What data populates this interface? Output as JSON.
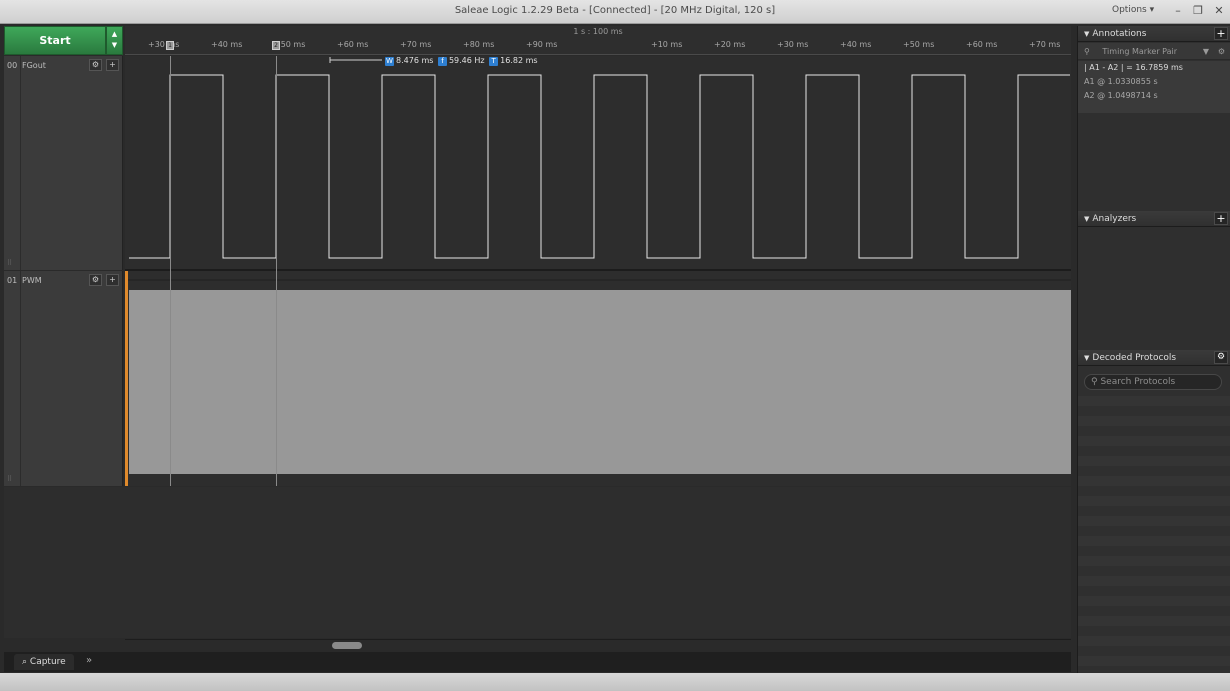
{
  "window": {
    "title": "Saleae Logic 1.2.29 Beta - [Connected] - [20 MHz Digital, 120 s]",
    "options_label": "Options ▾",
    "minimize_icon": "minimize-icon",
    "restore_icon": "restore-icon",
    "close_icon": "close-icon"
  },
  "toolbar": {
    "start_label": "Start"
  },
  "ruler": {
    "scale_label": "1 s : 100 ms",
    "ticks": [
      "+30 ms",
      "+40 ms",
      "+50 ms",
      "+60 ms",
      "+70 ms",
      "+80 ms",
      "+90 ms",
      "+10 ms",
      "+20 ms",
      "+30 ms",
      "+40 ms",
      "+50 ms",
      "+60 ms",
      "+70 ms"
    ],
    "marker_a1": "A1",
    "marker_a2": "A2"
  },
  "measurement": {
    "width_badge": "W",
    "width": "8.476 ms",
    "freq_badge": "f",
    "frequency": "59.46 Hz",
    "period_badge": "T",
    "period": "16.82 ms"
  },
  "channels": [
    {
      "num": "00",
      "name": "FGout",
      "settings_icon": "gear-icon",
      "add_icon": "add-analyzer-icon"
    },
    {
      "num": "01",
      "name": "PWM",
      "settings_icon": "gear-icon",
      "add_icon": "add-analyzer-icon"
    }
  ],
  "tabs": {
    "capture": "Capture",
    "more": "»"
  },
  "annotations": {
    "header": "Annotations",
    "timing_marker": "Timing Marker Pair",
    "delta_label": "| A1 - A2 | = 16.7859 ms",
    "a1_label": "A1",
    "a1_value": "@  1.0330855 s",
    "a2_label": "A2",
    "a2_value": "@  1.0498714 s"
  },
  "analyzers": {
    "header": "Analyzers"
  },
  "decoded": {
    "header": "Decoded Protocols",
    "search_placeholder": "Search Protocols"
  },
  "colors": {
    "start_green": "#2f8f47",
    "signal_line": "#ffffff",
    "pwm_fill": "#989898",
    "trigger_orange": "#e08a2c",
    "readout_blue": "#2e7fd1"
  }
}
